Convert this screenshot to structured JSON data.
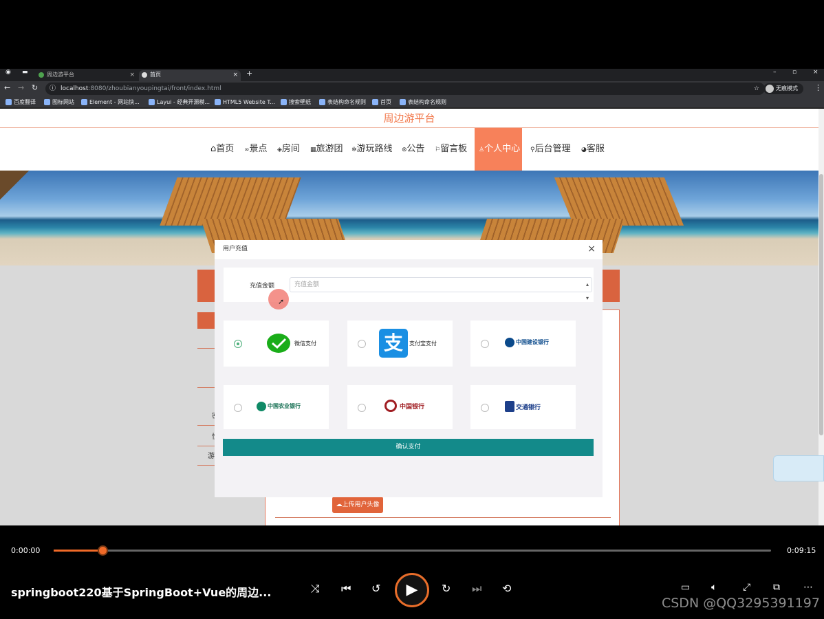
{
  "browser": {
    "tabs": [
      {
        "title": "周边游平台"
      },
      {
        "title": "首页"
      }
    ],
    "address": {
      "host": "localhost",
      "path": ":8080/zhoubianyoupingtai/front/index.html"
    },
    "profile_label": "无痕模式",
    "bookmarks": [
      "百度翻译",
      "图标网站",
      "Element - 网站快...",
      "Layui - 经典开源模...",
      "HTML5 Website T...",
      "搜索壁纸",
      "表结构命名规则",
      "首页",
      "表结构命名规则"
    ]
  },
  "site": {
    "title": "周边游平台",
    "nav": [
      {
        "label": "首页",
        "icon": "home-icon"
      },
      {
        "label": "景点",
        "icon": "binoculars-icon"
      },
      {
        "label": "房间",
        "icon": "tag-icon"
      },
      {
        "label": "旅游团",
        "icon": "calendar-icon"
      },
      {
        "label": "游玩路线",
        "icon": "gear-icon"
      },
      {
        "label": "公告",
        "icon": "compass-icon"
      },
      {
        "label": "留言板",
        "icon": "flag-icon"
      },
      {
        "label": "个人中心",
        "icon": "user-icon",
        "active": true
      },
      {
        "label": "后台管理",
        "icon": "link-icon"
      },
      {
        "label": "客服",
        "icon": "chat-icon"
      }
    ],
    "upload_avatar_label": "上传用户头像",
    "background_labels": [
      "密",
      "性",
      "游"
    ]
  },
  "modal": {
    "title": "用户充值",
    "close_symbol": "×",
    "amount_label": "充值金额",
    "amount_placeholder": "充值金额",
    "payment_options": [
      {
        "name": "微信支付",
        "icon": "wechat-pay-icon",
        "selected": true
      },
      {
        "name": "支付宝支付",
        "icon": "alipay-icon",
        "selected": false
      },
      {
        "name": "中国建设银行",
        "icon": "ccb-logo-icon",
        "selected": false
      },
      {
        "name": "中国农业银行",
        "icon": "abc-logo-icon",
        "selected": false
      },
      {
        "name": "中国银行",
        "icon": "boc-logo-icon",
        "selected": false
      },
      {
        "name": "交通银行",
        "icon": "bocom-logo-icon",
        "selected": false
      }
    ],
    "confirm_label": "确认支付"
  },
  "player": {
    "current_time": "0:00:00",
    "total_time": "0:09:15",
    "progress_fraction": 0.068,
    "video_title": "springboot220基于SpringBoot+Vue的周边...",
    "watermark": "CSDN @QQ3295391197"
  },
  "colors": {
    "accent": "#f7815a",
    "confirm": "#138a8a",
    "progress": "#f06a28"
  }
}
